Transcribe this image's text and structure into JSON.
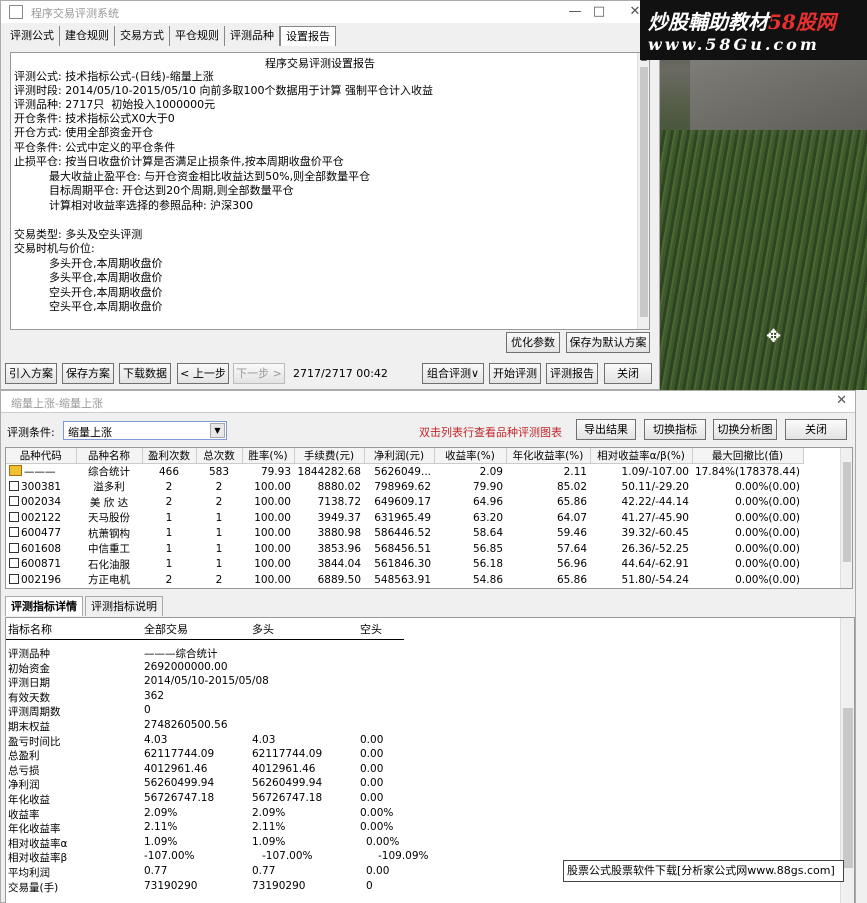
{
  "top_window": {
    "title": "程序交易评测系统",
    "controls": [
      "—",
      "□",
      "✕"
    ],
    "tabs": [
      "评测公式",
      "建仓规则",
      "交易方式",
      "平仓规则",
      "评测品种",
      "设置报告"
    ],
    "active_tab": 5,
    "report": {
      "title": "程序交易评测设置报告",
      "lines": [
        "评测公式: 技术指标公式-(日线)-缩量上涨",
        "评测时段: 2014/05/10-2015/05/10 向前多取100个数据用于计算 强制平仓计入收益",
        "评测品种: 2717只  初始投入1000000元",
        "开仓条件: 技术指标公式X0大于0",
        "开仓方式: 使用全部资金开仓",
        "平仓条件: 公式中定义的平仓条件",
        "止损平仓: 按当日收盘价计算是否满足止损条件,按本周期收盘价平仓",
        "          最大收益止盈平仓: 与开仓资金相比收益达到50%,则全部数量平仓",
        "          目标周期平仓: 开仓达到20个周期,则全部数量平仓",
        "          计算相对收益率选择的参照品种: 沪深300",
        "",
        "交易类型: 多头及空头评测",
        "交易时机与价位:",
        "          多头开仓,本周期收盘价",
        "          多头平仓,本周期收盘价",
        "          空头开仓,本周期收盘价",
        "          空头平仓,本周期收盘价"
      ]
    },
    "buttons": {
      "optimize": "优化参数",
      "save_default": "保存为默认方案",
      "import": "引入方案",
      "save": "保存方案",
      "download": "下载数据",
      "prev": "< 上一步",
      "next": "下一步 >",
      "progress": "2717/2717 00:42",
      "combo": "组合评测∨",
      "start": "开始评测",
      "report": "评测报告",
      "close": "关闭"
    }
  },
  "watermark": {
    "line1_a": "炒股輔助教材",
    "line1_b": "58股网",
    "line2": "www.58Gu.com"
  },
  "bottom_window": {
    "title": "缩量上涨-缩量上涨",
    "close": "✕",
    "condition_label": "评测条件:",
    "condition_value": "缩量上涨",
    "hint": "双击列表行查看品种评测图表",
    "buttons": {
      "export": "导出结果",
      "switch_indicator": "切换指标",
      "switch_chart": "切换分析图",
      "close": "关闭"
    },
    "grid": {
      "columns": [
        "品种代码",
        "品种名称",
        "盈利次数",
        "总次数",
        "胜率(%)",
        "手续费(元)",
        "净利润(元)",
        "收益率(%)",
        "年化收益率(%)",
        "相对收益率α/β(%)",
        "最大回撤比(值)"
      ],
      "rows": [
        [
          "———",
          "综合统计",
          "466",
          "583",
          "79.93",
          "1844282.68",
          "5626049...",
          "2.09",
          "2.11",
          "1.09/-107.00",
          "17.84%(178378.44)"
        ],
        [
          "300381",
          "溢多利",
          "2",
          "2",
          "100.00",
          "8880.02",
          "798969.62",
          "79.90",
          "85.02",
          "50.11/-29.20",
          "0.00%(0.00)"
        ],
        [
          "002034",
          "美 欣 达",
          "2",
          "2",
          "100.00",
          "7138.72",
          "649609.17",
          "64.96",
          "65.86",
          "42.22/-44.14",
          "0.00%(0.00)"
        ],
        [
          "002122",
          "天马股份",
          "1",
          "1",
          "100.00",
          "3949.37",
          "631965.49",
          "63.20",
          "64.07",
          "41.27/-45.90",
          "0.00%(0.00)"
        ],
        [
          "600477",
          "杭萧钢构",
          "1",
          "1",
          "100.00",
          "3880.98",
          "586446.52",
          "58.64",
          "59.46",
          "39.32/-60.45",
          "0.00%(0.00)"
        ],
        [
          "601608",
          "中信重工",
          "1",
          "1",
          "100.00",
          "3853.96",
          "568456.51",
          "56.85",
          "57.64",
          "26.36/-52.25",
          "0.00%(0.00)"
        ],
        [
          "600871",
          "石化油服",
          "1",
          "1",
          "100.00",
          "3844.04",
          "561846.30",
          "56.18",
          "56.96",
          "44.64/-62.91",
          "0.00%(0.00)"
        ],
        [
          "002196",
          "方正电机",
          "2",
          "2",
          "100.00",
          "6889.50",
          "548563.91",
          "54.86",
          "65.86",
          "51.80/-54.24",
          "0.00%(0.00)"
        ]
      ]
    },
    "detail_tabs": [
      "评测指标详情",
      "评测指标说明"
    ],
    "detail": {
      "headers": [
        "指标名称",
        "全部交易",
        "多头",
        "空头"
      ],
      "rows": [
        [
          "评测品种",
          "———综合统计",
          "",
          ""
        ],
        [
          "初始资金",
          "2692000000.00",
          "",
          ""
        ],
        [
          "评测日期",
          "2014/05/10-2015/05/08",
          "",
          ""
        ],
        [
          "有效天数",
          "362",
          "",
          ""
        ],
        [
          "评测周期数",
          "0",
          "",
          ""
        ],
        [
          "期末权益",
          "2748260500.56",
          "",
          ""
        ],
        [
          "盈亏时间比",
          "4.03",
          "4.03",
          "0.00"
        ],
        [
          "总盈利",
          "62117744.09",
          "62117744.09",
          "0.00"
        ],
        [
          "总亏损",
          "4012961.46",
          "4012961.46",
          "0.00"
        ],
        [
          "净利润",
          "56260499.94",
          "56260499.94",
          "0.00"
        ],
        [
          "年化收益",
          "56726747.18",
          "56726747.18",
          "0.00"
        ],
        [
          "收益率",
          "2.09%",
          "2.09%",
          "0.00%"
        ],
        [
          "年化收益率",
          "2.11%",
          "2.11%",
          "0.00%"
        ],
        [
          "相对收益率α",
          "1.09%",
          "1.09%",
          "0.00%"
        ],
        [
          "相对收益率β",
          "-107.00%",
          "-107.00%",
          "-109.09%"
        ],
        [
          "平均利润",
          "0.77",
          "0.77",
          "0.00"
        ],
        [
          "交易量(手)",
          "73190290",
          "73190290",
          "0"
        ]
      ]
    }
  },
  "ad_banner": "股票公式股票软件下载[分析家公式网www.88gs.com]"
}
